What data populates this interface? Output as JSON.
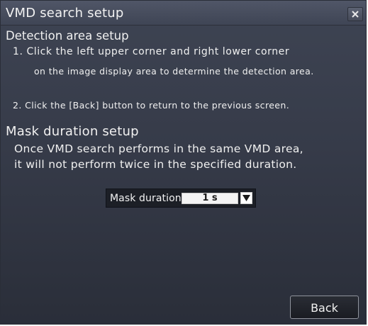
{
  "window": {
    "title": "VMD search setup",
    "close_icon": "close-icon"
  },
  "detection": {
    "heading": "Detection area setup",
    "step1_line1": "1. Click the left upper corner and right lower corner",
    "step1_line2": "on the image display area to determine the detection area.",
    "step2": "2. Click the [Back] button to return to the previous screen."
  },
  "mask": {
    "heading": "Mask duration setup",
    "desc_line1": "Once VMD search performs in the same  VMD area,",
    "desc_line2": "it will not perform twice in the specified duration.",
    "field_label": "Mask duration",
    "selected_value": "1 s",
    "dropdown_icon": "chevron-down-icon"
  },
  "footer": {
    "back_label": "Back"
  }
}
